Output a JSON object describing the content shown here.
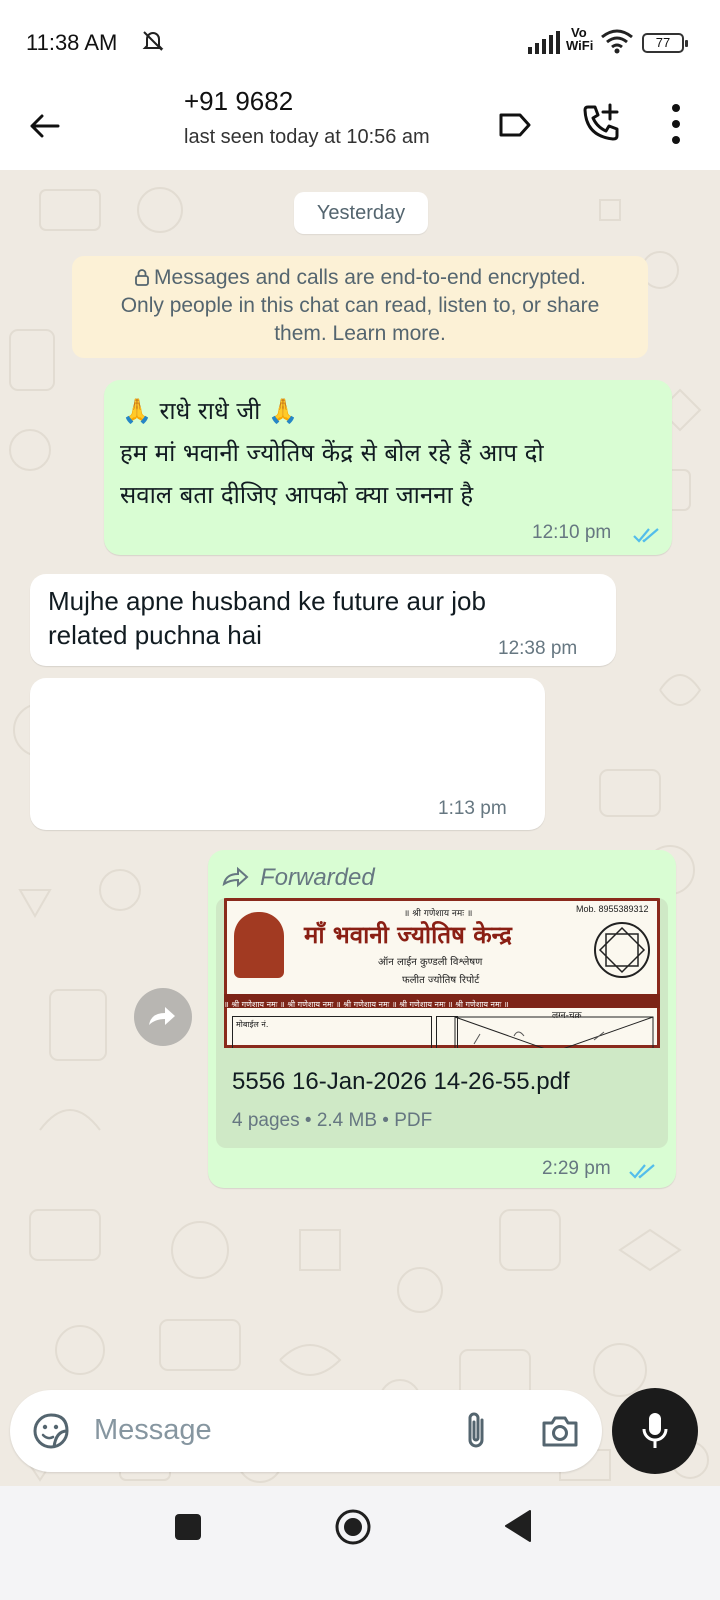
{
  "status_bar": {
    "time": "11:38 AM",
    "vowifi_top": "Vo",
    "vowifi_bottom": "WiFi",
    "battery": "77"
  },
  "header": {
    "contact": "+91 9682",
    "last_seen": "last seen today at 10:56 am",
    "icons": [
      "back-arrow-icon",
      "label-icon",
      "add-call-icon",
      "more-vert-icon"
    ]
  },
  "chat": {
    "date_chip": "Yesterday",
    "encryption_notice": {
      "line1": "Messages and calls are end-to-end encrypted.",
      "line2": "Only people in this chat can read, listen to, or share",
      "line3": "them. Learn more."
    },
    "messages": [
      {
        "direction": "outgoing",
        "line1": "🙏 राधे राधे जी 🙏",
        "line2": "हम मां भवानी ज्योतिष केंद्र से बोल रहे हैं आप दो",
        "line3": "सवाल बता दीजिए आपको क्या जानना है",
        "time": "12:10 pm",
        "status": "read"
      },
      {
        "direction": "incoming",
        "line1": "Mujhe apne husband ke future aur job",
        "line2": "related puchna hai",
        "time": "12:38 pm"
      },
      {
        "direction": "incoming",
        "time": "1:13 pm"
      },
      {
        "direction": "outgoing",
        "forwarded_label": "Forwarded",
        "document": {
          "name": "5556 16-Jan-2026 14-26-55.pdf",
          "meta": "4 pages • 2.4 MB • PDF",
          "preview_title": "माँ भवानी ज्योतिष केन्द्र",
          "preview_top": "॥ श्री गणेशाय नमः ॥",
          "preview_mob": "Mob. 8955389312",
          "preview_sub1": "ऑन लाईन कुण्डली विश्लेषण",
          "preview_sub2": "फलीत ज्योतिष रिपोर्ट",
          "preview_strip": "॥ श्री गणेशाय नमः ॥ श्री गणेशाय नमः ॥ श्री गणेशाय नमः ॥ श्री गणेशाय नमः ॥ श्री गणेशाय नमः ॥",
          "preview_field": "मोबाईल नं.",
          "preview_chart": "लग्न-चक्र"
        },
        "time": "2:29 pm",
        "status": "read"
      }
    ]
  },
  "composer": {
    "placeholder": "Message"
  },
  "colors": {
    "outgoing_bubble": "#d9fdd3",
    "incoming_bubble": "#ffffff",
    "read_ticks": "#53bdeb",
    "chat_background": "#efeae2",
    "encryption_bg": "#fcf1d6"
  }
}
